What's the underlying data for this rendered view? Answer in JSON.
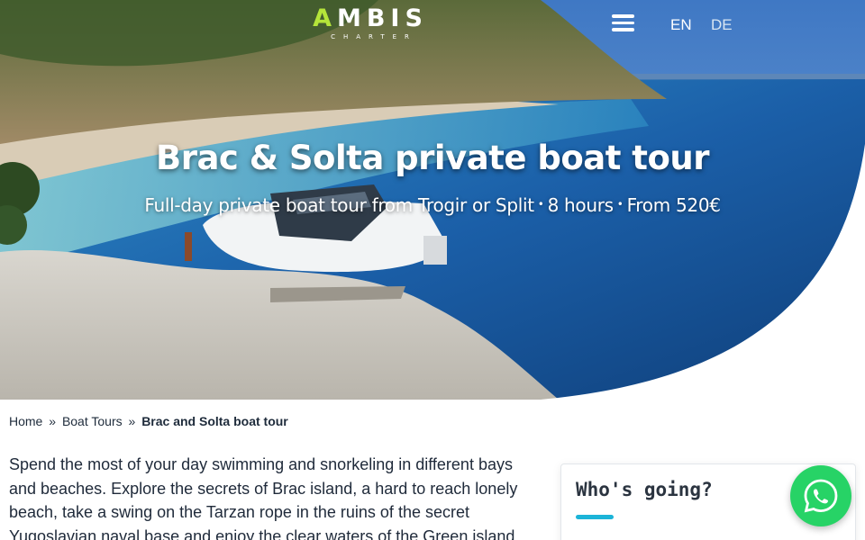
{
  "brand": {
    "logo_main_accent": "A",
    "logo_main_rest": "MBIS",
    "logo_sub": "CHARTER",
    "accent_color": "#b5e43a"
  },
  "header": {
    "menu_icon": "hamburger-icon",
    "languages": [
      "EN",
      "DE"
    ]
  },
  "hero": {
    "title": "Brac & Solta private boat tour",
    "subtitle_parts": [
      "Full-day private boat tour from Trogir or Split",
      "8 hours",
      "From 520€"
    ],
    "separator": "•"
  },
  "breadcrumb": {
    "home": "Home",
    "sep": "»",
    "section": "Boat Tours",
    "current": "Brac and Solta boat tour"
  },
  "intro_text": "Spend the most of your day swimming and snorkeling in different bays and beaches. Explore the secrets of Brac island, a hard to reach lonely beach, take a swing on the Tarzan rope in the ruins of the secret Yugoslavian naval base and enjoy the clear waters of the Green island",
  "booking_card": {
    "title": "Who's going?",
    "underline_color": "#1cb4d8"
  },
  "whatsapp": {
    "icon": "whatsapp-icon",
    "color": "#27d366"
  }
}
